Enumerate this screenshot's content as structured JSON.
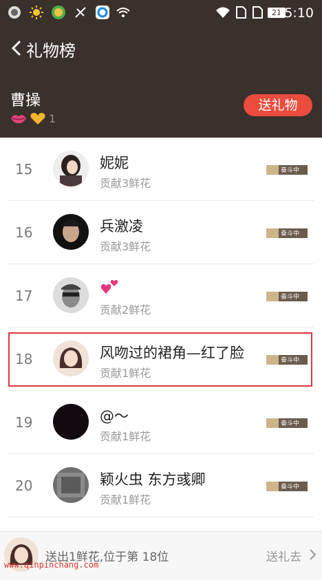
{
  "status_bar": {
    "time": "15:10",
    "battery": "21"
  },
  "header": {
    "back_icon": "chevron-left-icon",
    "title": "礼物榜",
    "username": "曹操",
    "level": "1",
    "send_button": "送礼物"
  },
  "list": [
    {
      "rank": "15",
      "name": "妮妮",
      "contribution": "贡献3鲜花",
      "tag": "奋斗中"
    },
    {
      "rank": "16",
      "name": "兵激凌",
      "contribution": "贡献3鲜花",
      "tag": "奋斗中"
    },
    {
      "rank": "17",
      "name": "",
      "contribution": "贡献2鲜花",
      "tag": "奋斗中"
    },
    {
      "rank": "18",
      "name": "风吻过的裙角—红了脸",
      "contribution": "贡献1鲜花",
      "tag": "奋斗中"
    },
    {
      "rank": "19",
      "name": "@〜",
      "contribution": "贡献1鲜花",
      "tag": "奋斗中"
    },
    {
      "rank": "20",
      "name": "颖火虫  东方彧卿",
      "contribution": "贡献1鲜花",
      "tag": "奋斗中"
    }
  ],
  "footer": {
    "summary": "送出1鲜花,位于第 18位",
    "action": "送礼去"
  },
  "watermark": "www.qinpinchang.com",
  "colors": {
    "header_bg": "#3a302c",
    "accent": "#ec4c3e",
    "highlight_border": "#e2363a"
  }
}
